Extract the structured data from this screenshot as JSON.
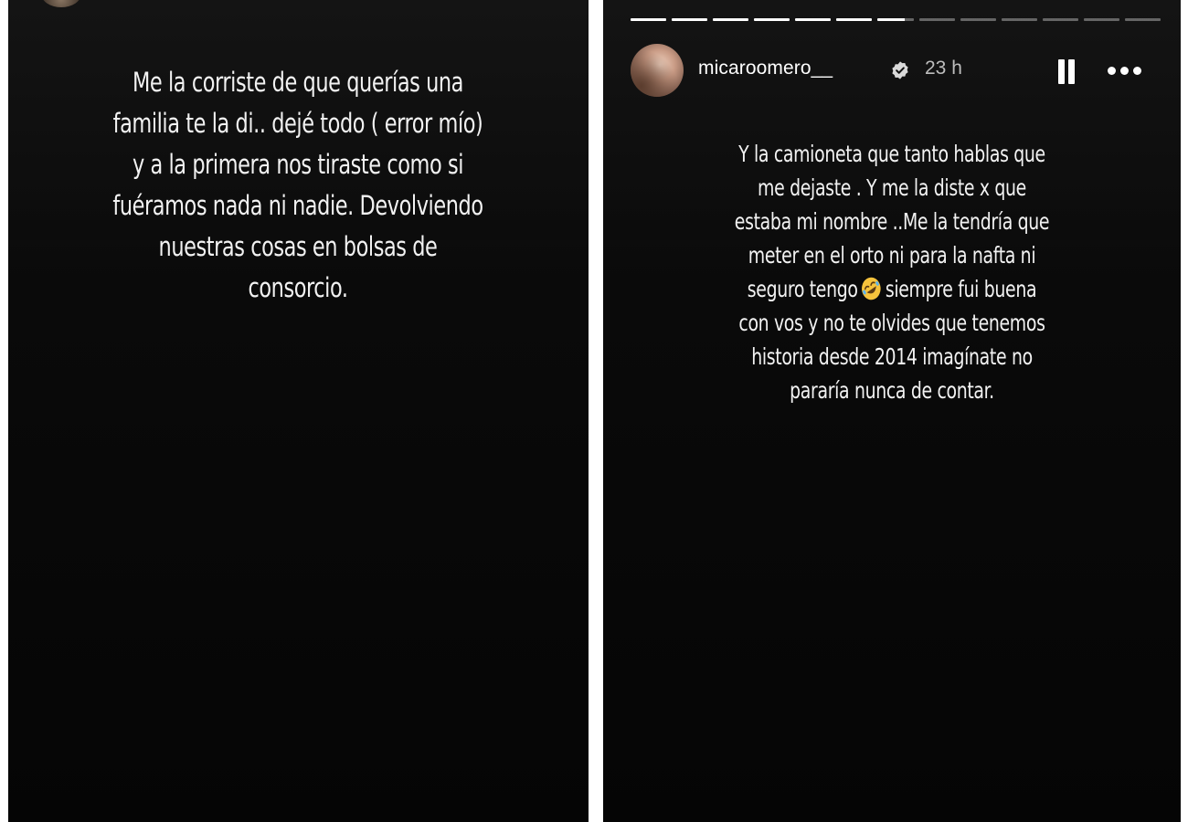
{
  "left_story": {
    "lines": [
      "Me la corriste de que querías una",
      "familia te la di.. dejé todo ( error mío)",
      "y a la primera nos tiraste como si",
      "fuéramos nada ni nadie. Devolviendo",
      "nuestras cosas en bolsas de",
      "consorcio."
    ]
  },
  "right_story": {
    "progress": {
      "total_segments": 13,
      "viewed_segments": 6,
      "current_fraction": 0.75
    },
    "header": {
      "username": "micaroomero__",
      "timestamp": "23 h",
      "verified_icon": "verified-badge-icon",
      "pause_icon": "pause-icon",
      "more_icon": "more-options-icon"
    },
    "lines": [
      "Y la camioneta que tanto hablas que",
      "me dejaste . Y me la diste x que",
      "estaba mi nombre ..Me la tendría que",
      "meter en el orto ni para la nafta ni"
    ],
    "line_with_emoji_before": "seguro tengo",
    "emoji_name": "rolling-on-floor-laughing-emoji",
    "line_with_emoji_after": "siempre fui buena",
    "lines_after": [
      "con vos y no te olvides que tenemos",
      "historia desde 2014 imagínate no",
      "pararía nunca de contar."
    ]
  },
  "colors": {
    "background": "#0a0a0a",
    "text": "#f2f2f2",
    "timestamp": "#bdbdbd",
    "emoji": "#f6c33c"
  }
}
